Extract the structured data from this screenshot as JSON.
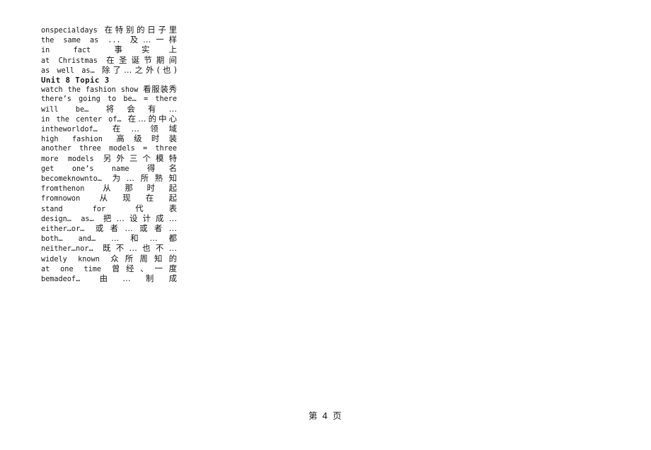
{
  "document": {
    "type": "vocabulary-list",
    "footer": "第 4 页",
    "page_number": "4",
    "entries": [
      {
        "english": "onspecialdays",
        "chinese": "在特别的日子里"
      },
      {
        "english": "the same as ...",
        "chinese": "及…一样"
      },
      {
        "english": "in fact",
        "chinese": "事实上"
      },
      {
        "english": "at Christmas",
        "chinese": "在圣诞节期间"
      },
      {
        "english": "as well as…",
        "chinese": "除了…之外(也)"
      },
      {
        "english": "Unit 8 Topic 3",
        "chinese": "",
        "heading": true
      },
      {
        "english": "watch the fashion show",
        "chinese": "看服装秀"
      },
      {
        "english": "there’s going to be… = there will be…",
        "chinese": "将会有…"
      },
      {
        "english": "in the center of…",
        "chinese": "在…的中心"
      },
      {
        "english": "intheworldof…",
        "chinese": "在…领域"
      },
      {
        "english": "high fashion",
        "chinese": "高级时装"
      },
      {
        "english": "another three models = three more models",
        "chinese": "另外三个模特"
      },
      {
        "english": "get one’s name",
        "chinese": "得名"
      },
      {
        "english": "becomeknownto…",
        "chinese": "为…所熟知"
      },
      {
        "english": "fromthenon",
        "chinese": "从那时起"
      },
      {
        "english": "fromnowon",
        "chinese": "从现在起"
      },
      {
        "english": "stand for",
        "chinese": "代表"
      },
      {
        "english": "design… as…",
        "chinese": "把…设计成…"
      },
      {
        "english": "either…or…",
        "chinese": "或者…或者…"
      },
      {
        "english": "both… and…",
        "chinese": "…和…都"
      },
      {
        "english": "neither…nor…",
        "chinese": "既不…也不…"
      },
      {
        "english": "widely known",
        "chinese": "众所周知的"
      },
      {
        "english": "at one time",
        "chinese": "曾经、一度"
      },
      {
        "english": "bemadeof…",
        "chinese": "由…制成"
      }
    ]
  }
}
